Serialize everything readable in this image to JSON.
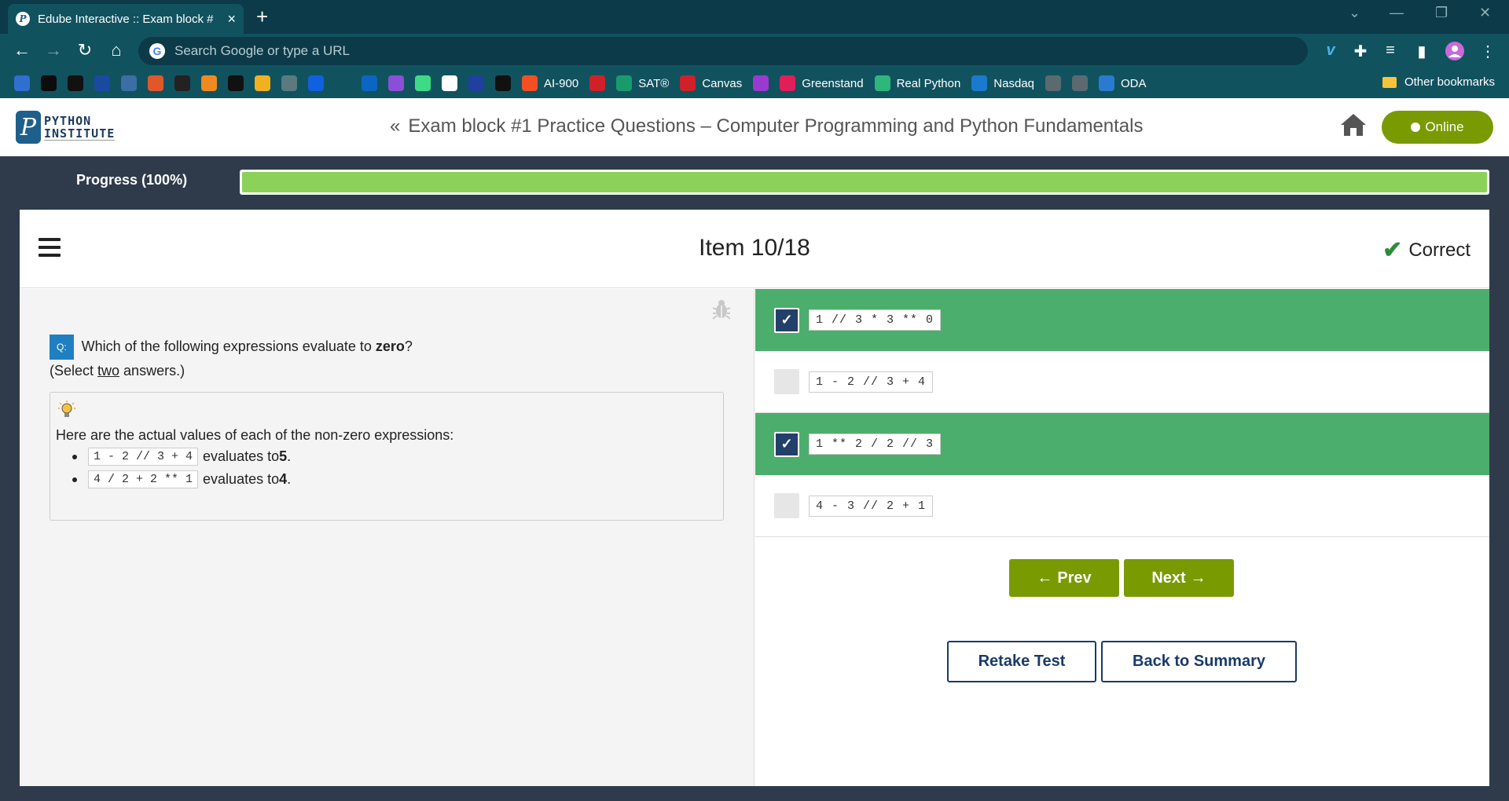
{
  "browser": {
    "tab_title": "Edube Interactive :: Exam block #",
    "tab_favicon": "P",
    "new_tab": "+",
    "address_placeholder": "Search Google or type a URL",
    "bookmarks": [
      {
        "label": "",
        "icon": "cube-icon",
        "color": "#2f6fd0"
      },
      {
        "label": "",
        "icon": "github-icon",
        "color": "#0c0c0c"
      },
      {
        "label": "",
        "icon": "target-icon",
        "color": "#111111"
      },
      {
        "label": "",
        "icon": "p-icon",
        "color": "#1a4aa0"
      },
      {
        "label": "",
        "icon": "python-icon",
        "color": "#3a6ea5"
      },
      {
        "label": "",
        "icon": "swirl-icon",
        "color": "#e0582a"
      },
      {
        "label": "",
        "icon": "lambda-icon",
        "color": "#222222"
      },
      {
        "label": "",
        "icon": "slash-icon",
        "color": "#f08a20"
      },
      {
        "label": "",
        "icon": "hi-icon",
        "color": "#111111"
      },
      {
        "label": "",
        "icon": "layers-icon",
        "color": "#f0b020"
      },
      {
        "label": "",
        "icon": "dots-icon",
        "color": "#5a7a80"
      },
      {
        "label": "",
        "icon": "c-icon",
        "color": "#1060e0"
      },
      {
        "label": "",
        "icon": "edx-icon",
        "color": "#11525f"
      },
      {
        "label": "",
        "icon": "linkedin-icon",
        "color": "#0a66c2"
      },
      {
        "label": "",
        "icon": "u-icon",
        "color": "#8a4fd8"
      },
      {
        "label": "",
        "icon": "android-icon",
        "color": "#3ddc84"
      },
      {
        "label": "",
        "icon": "code-icon",
        "color": "#ffffff"
      },
      {
        "label": "",
        "icon": "bracket-icon",
        "color": "#2040a0"
      },
      {
        "label": "",
        "icon": "terminal-icon",
        "color": "#111111"
      },
      {
        "label": "AI-900",
        "icon": "microsoft-icon",
        "color": "#f25022"
      },
      {
        "label": "",
        "icon": "shield-icon",
        "color": "#d0202a"
      },
      {
        "label": "SAT®",
        "icon": "check-shield-icon",
        "color": "#1a9a6a"
      },
      {
        "label": "Canvas",
        "icon": "canvas-icon",
        "color": "#d0202a"
      },
      {
        "label": "",
        "icon": "ed-icon",
        "color": "#9a3ad0"
      },
      {
        "label": "Greenstand",
        "icon": "slack-icon",
        "color": "#e01e5a"
      },
      {
        "label": "Real Python",
        "icon": "slack-icon",
        "color": "#2eb67d"
      },
      {
        "label": "Nasdaq",
        "icon": "chart-icon",
        "color": "#1a7ad0"
      },
      {
        "label": "",
        "icon": "aai-icon",
        "color": "#5a6a70"
      },
      {
        "label": "",
        "icon": "mw-icon",
        "color": "#5a6a70"
      },
      {
        "label": "ODA",
        "icon": "dollar-icon",
        "color": "#2a7ad0"
      }
    ],
    "other_bookmarks": "Other bookmarks"
  },
  "header": {
    "logo_line1": "PYTHON",
    "logo_line2": "INSTITUTE",
    "logo_mark": "P",
    "breadcrumb_chevron": "«",
    "title": "Exam block #1 Practice Questions – Computer Programming and Python Fundamentals",
    "online_label": "Online"
  },
  "progress": {
    "label": "Progress (100%)",
    "value": 1.0
  },
  "item": {
    "title": "Item 10/18",
    "status": "Correct",
    "status_icon": "✔"
  },
  "question": {
    "badge": "Q:",
    "text_before": "Which of the following expressions evaluate to ",
    "text_bold": "zero",
    "text_after": "?",
    "select_prefix": "(Select ",
    "select_underlined": "two",
    "select_suffix": " answers.)"
  },
  "hint": {
    "intro": "Here are the actual values of each of the non-zero expressions:",
    "items": [
      {
        "expr": "1 - 2 // 3 + 4",
        "mid": "evaluates to ",
        "value": "5",
        "end": "."
      },
      {
        "expr": "4 / 2 + 2 ** 1",
        "mid": "evaluates to ",
        "value": "4",
        "end": "."
      }
    ]
  },
  "answers": [
    {
      "expr": "1 // 3 * 3 ** 0",
      "checked": true
    },
    {
      "expr": "1 - 2 // 3 + 4",
      "checked": false
    },
    {
      "expr": "1 ** 2 / 2 // 3",
      "checked": true
    },
    {
      "expr": "4 - 3 // 2 + 1",
      "checked": false
    }
  ],
  "buttons": {
    "prev": "Prev",
    "next": "Next",
    "retake": "Retake Test",
    "back": "Back to Summary"
  },
  "colors": {
    "selected_answer": "#4cae6c",
    "accent_green": "#7a9a01",
    "progress_fill": "#8cd25a",
    "navy": "#1a3a6a"
  }
}
